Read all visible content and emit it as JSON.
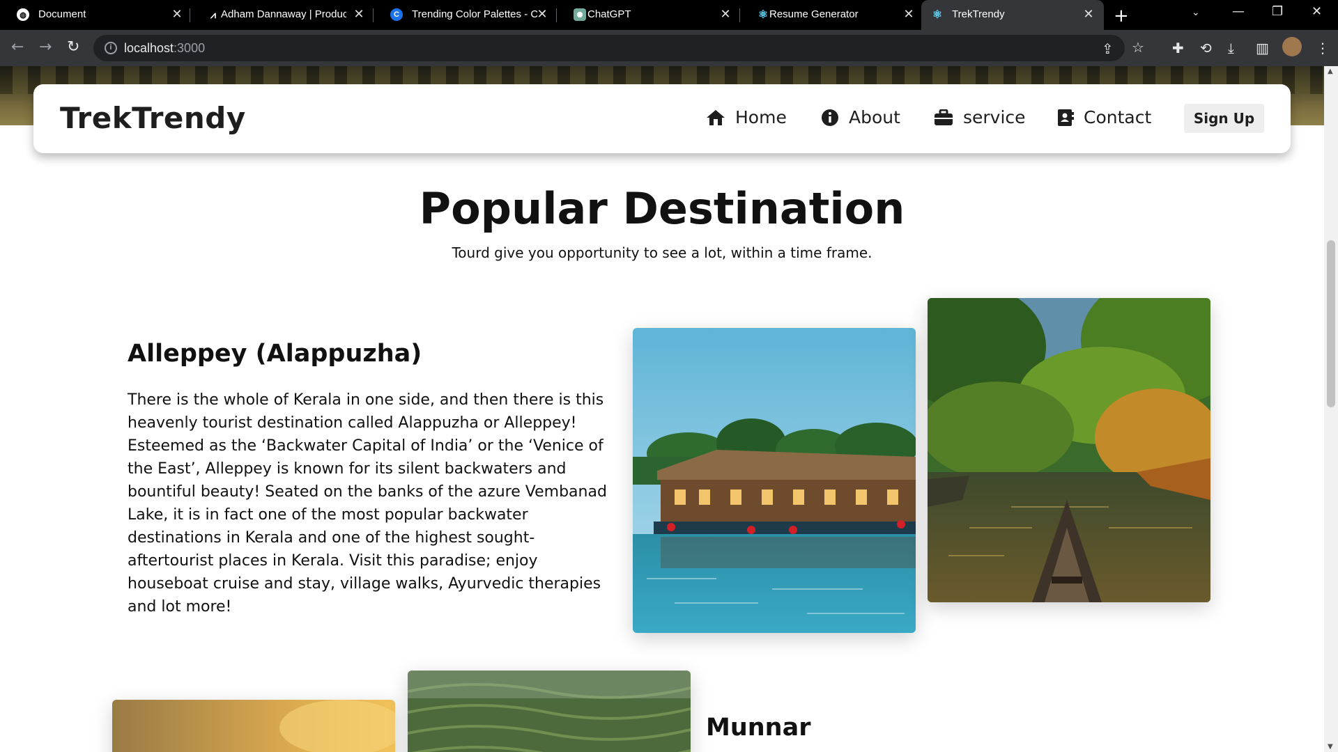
{
  "browser": {
    "tabs": [
      {
        "title": "Document",
        "icon": "globe-icon"
      },
      {
        "title": "Adham Dannaway | Produc",
        "icon": "ad-logo-icon"
      },
      {
        "title": "Trending Color Palettes - Co",
        "icon": "coolors-icon"
      },
      {
        "title": "ChatGPT",
        "icon": "chatgpt-icon"
      },
      {
        "title": "Resume Generator",
        "icon": "react-icon"
      },
      {
        "title": "TrekTrendy",
        "icon": "react-icon",
        "active": true
      }
    ],
    "url_host": "localhost",
    "url_port": ":3000"
  },
  "navbar": {
    "brand": "TrekTrendy",
    "links": [
      {
        "label": "Home",
        "icon": "home-icon"
      },
      {
        "label": "About",
        "icon": "info-icon"
      },
      {
        "label": "service",
        "icon": "briefcase-icon"
      },
      {
        "label": "Contact",
        "icon": "contact-book-icon"
      }
    ],
    "signup": "Sign Up"
  },
  "section": {
    "title": "Popular Destination",
    "subtitle": "Tourd give you opportunity to see a lot, within a time frame."
  },
  "destinations": [
    {
      "name": "Alleppey (Alappuzha)",
      "description": "There is the whole of Kerala in one side, and then there is this heavenly tourist destination called Alappuzha or Alleppey! Esteemed as the ‘Backwater Capital of India’ or the ‘Venice of the East’, Alleppey is known for its silent backwaters and bountiful beauty! Seated on the banks of the azure Vembanad Lake, it is in fact one of the most popular backwater destinations in Kerala and one of the highest sought-aftertourist places in Kerala. Visit this paradise; enjoy houseboat cruise and stay, village walks, Ayurvedic therapies and lot more!"
    },
    {
      "name": "Munnar"
    }
  ],
  "colors": {
    "chrome_dark": "#000000",
    "chrome_toolbar": "#35363a",
    "text": "#111111",
    "signup_bg": "#eeeeee"
  }
}
